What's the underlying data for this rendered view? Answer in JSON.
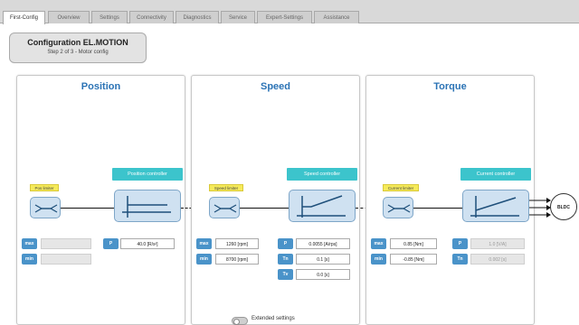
{
  "tabs": [
    {
      "label": "First-Config",
      "active": true
    },
    {
      "label": "Overview"
    },
    {
      "label": "Settings"
    },
    {
      "label": "Connectivity"
    },
    {
      "label": "Diagnostics"
    },
    {
      "label": "Service"
    },
    {
      "label": "Expert-Settings"
    },
    {
      "label": "Assistance"
    }
  ],
  "config": {
    "title": "Configuration EL.MOTION",
    "subtitle": "Step 2 of 3 - Motor config"
  },
  "panels": {
    "position": {
      "title": "Position",
      "limiter_label": "Pos limiter",
      "controller_label": "Position controller",
      "max_label": "max",
      "min_label": "min",
      "p_label": "P",
      "p_value": "40.0 [R/s²]"
    },
    "speed": {
      "title": "Speed",
      "limiter_label": "Speed limiter",
      "controller_label": "Speed controller",
      "max_label": "max",
      "min_label": "min",
      "max_value": "1260 [rpm]",
      "min_value": "8700 [rpm]",
      "p_label": "P",
      "tn_label": "Tn",
      "tv_label": "Tv",
      "p_value": "0.0055 [A/rps]",
      "tn_value": "0.1 [s]",
      "tv_value": "0.0 [s]"
    },
    "torque": {
      "title": "Torque",
      "limiter_label": "Current limiter",
      "controller_label": "Current controller",
      "max_label": "max",
      "min_label": "min",
      "max_value": "0.85 [Nm]",
      "min_value": "-0.85 [Nm]",
      "p_label": "P",
      "tn_label": "Tn",
      "p_value": "1.0 [V/A]",
      "tn_value": "0.002 [s]"
    }
  },
  "motor_label": "BLDC",
  "extended_settings_label": "Extended settings",
  "colors": {
    "title_blue": "#2b73b5",
    "controller_teal": "#3cc4cc",
    "limiter_yellow": "#f5ea5a",
    "button_blue": "#4a93c9"
  }
}
